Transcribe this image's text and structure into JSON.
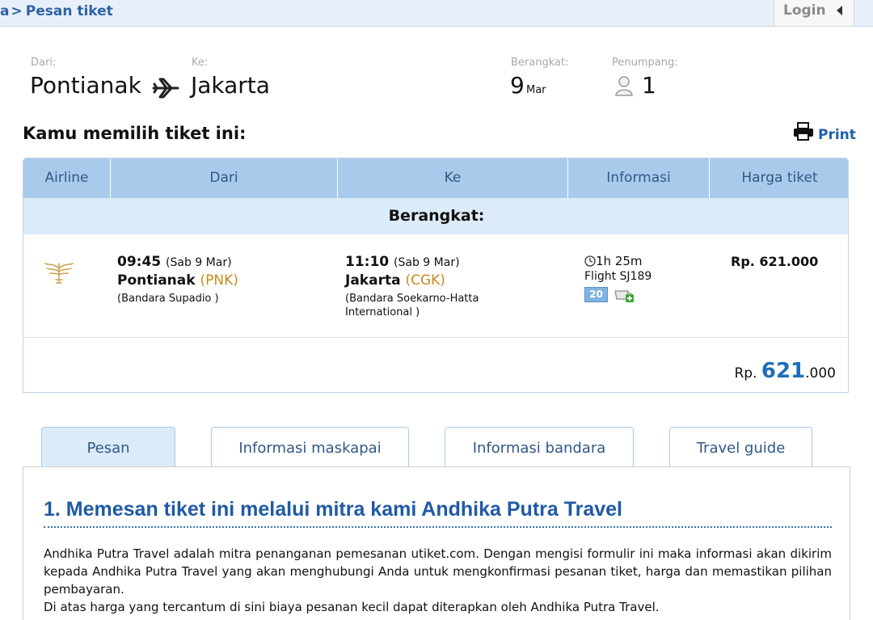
{
  "topbar": {
    "breadcrumb_prefix": "a",
    "breadcrumb_sep": ">",
    "breadcrumb_current": "Pesan tiket",
    "login_label": "Login"
  },
  "search": {
    "from_label": "Dari:",
    "from_city": "Pontianak",
    "to_label": "Ke:",
    "to_city": "Jakarta",
    "depart_label": "Berangkat:",
    "depart_day": "9",
    "depart_month": "Mar",
    "pax_label": "Penumpang:",
    "pax_count": "1"
  },
  "section_title": "Kamu memilih tiket ini:",
  "print_label": "Print",
  "table": {
    "headers": [
      "Airline",
      "Dari",
      "Ke",
      "Informasi",
      "Harga tiket"
    ],
    "group_label": "Berangkat:",
    "flight": {
      "dep_time": "09:45",
      "dep_day": "(Sab 9 Mar)",
      "dep_city": "Pontianak",
      "dep_code": "(PNK)",
      "dep_airport": "(Bandara Supadio )",
      "arr_time": "11:10",
      "arr_day": "(Sab 9 Mar)",
      "arr_city": "Jakarta",
      "arr_code": "(CGK)",
      "arr_airport_line1": "(Bandara Soekarno-Hatta",
      "arr_airport_line2": "International )",
      "duration": "1h 25m",
      "flight_no": "Flight SJ189",
      "baggage": "20",
      "price": "Rp. 621.000"
    },
    "total": {
      "prefix": "Rp.",
      "big": "621",
      "suffix": ".000"
    }
  },
  "tabs": [
    {
      "label": "Pesan"
    },
    {
      "label": "Informasi maskapai"
    },
    {
      "label": "Informasi bandara"
    },
    {
      "label": "Travel guide"
    }
  ],
  "panel": {
    "title": "1. Memesan tiket ini melalui mitra kami Andhika Putra Travel",
    "paragraph1": "Andhika Putra Travel adalah mitra penanganan pemesanan utiket.com. Dengan mengisi formulir ini maka informasi akan dikirim kepada Andhika Putra Travel yang akan menghubungi Anda untuk mengkonfirmasi pesanan tiket, harga dan memastikan pilihan pembayaran.",
    "paragraph2": "Di atas harga yang tercantum di sini biaya pesanan kecil dapat diterapkan oleh Andhika Putra Travel."
  },
  "colors": {
    "accent": "#1f5aa5",
    "header_bg": "#a9cbeb",
    "row_bg": "#dcebf8",
    "code_orange": "#c98a1c"
  }
}
